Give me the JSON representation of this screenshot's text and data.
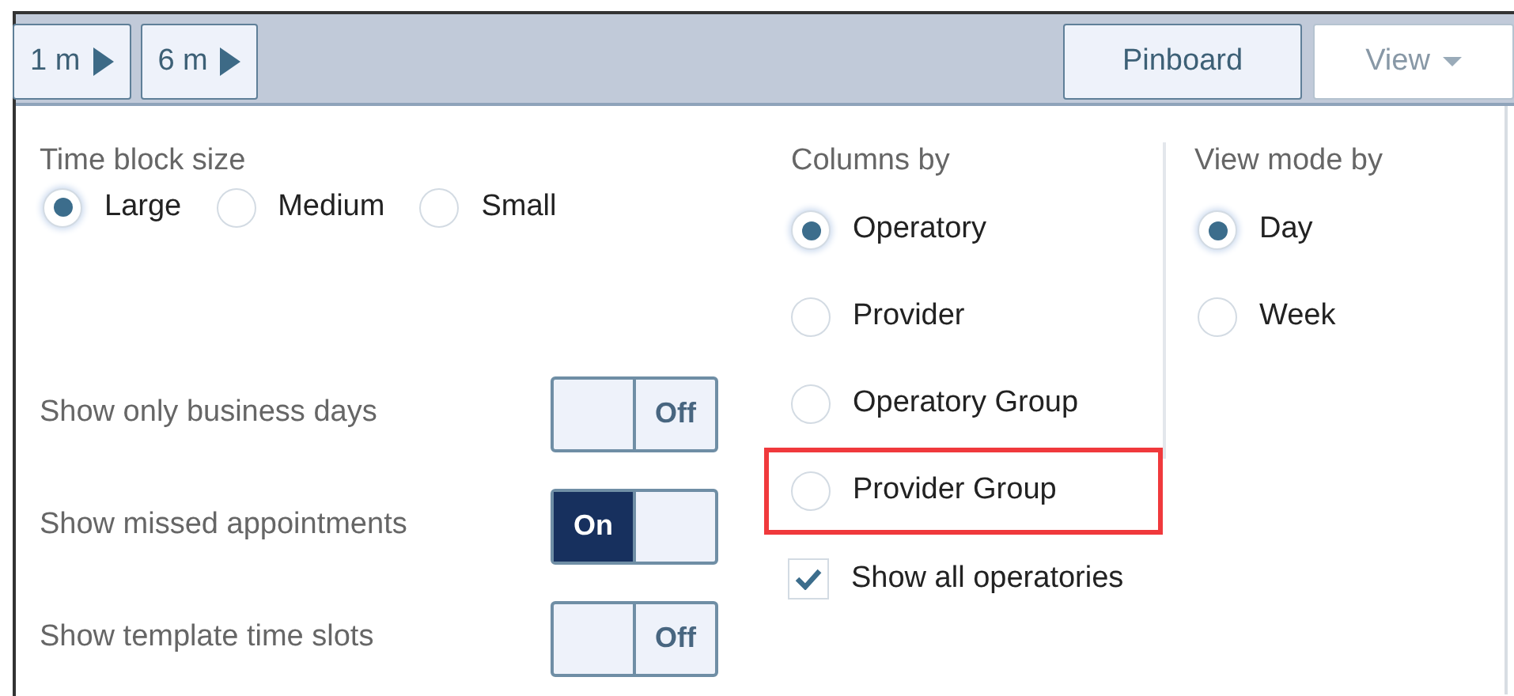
{
  "toolbar": {
    "left_buttons": [
      {
        "label": "1 m"
      },
      {
        "label": "6 m"
      }
    ],
    "pinboard": {
      "label": "Pinboard"
    },
    "view": {
      "label": "View"
    }
  },
  "time_block_size": {
    "title": "Time block size",
    "options": [
      {
        "label": "Large",
        "selected": true
      },
      {
        "label": "Medium",
        "selected": false
      },
      {
        "label": "Small",
        "selected": false
      }
    ]
  },
  "switches": [
    {
      "label": "Show only business days",
      "on": false,
      "switch_text": "Off"
    },
    {
      "label": "Show missed appointments",
      "on": true,
      "switch_text": "On"
    },
    {
      "label": "Show template time slots",
      "on": false,
      "switch_text": "Off"
    }
  ],
  "columns_by": {
    "title": "Columns by",
    "options": [
      {
        "label": "Operatory",
        "selected": true,
        "highlighted": false
      },
      {
        "label": "Provider",
        "selected": false,
        "highlighted": false
      },
      {
        "label": "Operatory Group",
        "selected": false,
        "highlighted": false
      },
      {
        "label": "Provider Group",
        "selected": false,
        "highlighted": true
      }
    ]
  },
  "show_all_operatories": {
    "label": "Show all operatories",
    "checked": true
  },
  "view_mode_by": {
    "title": "View mode by",
    "options": [
      {
        "label": "Day",
        "selected": true
      },
      {
        "label": "Week",
        "selected": false
      }
    ]
  }
}
